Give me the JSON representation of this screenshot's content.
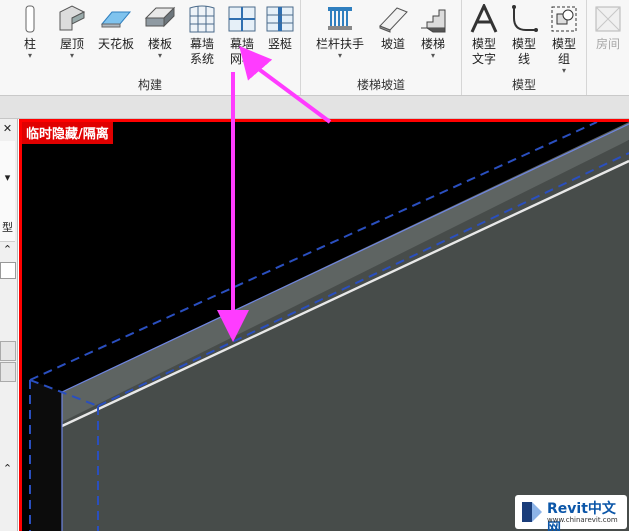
{
  "ribbon": {
    "build_group": {
      "label": "构建",
      "tools": [
        {
          "label": "柱",
          "has_dropdown": true
        },
        {
          "label": "屋顶",
          "has_dropdown": true
        },
        {
          "label": "天花板",
          "has_dropdown": false
        },
        {
          "label": "楼板",
          "has_dropdown": true
        },
        {
          "label": "幕墙\n系统",
          "has_dropdown": false
        },
        {
          "label": "幕墙\n网格",
          "has_dropdown": false
        },
        {
          "label": "竖梃",
          "has_dropdown": false
        }
      ]
    },
    "stairs_group": {
      "label": "楼梯坡道",
      "tools": [
        {
          "label": "栏杆扶手",
          "has_dropdown": true
        },
        {
          "label": "坡道",
          "has_dropdown": false
        },
        {
          "label": "楼梯",
          "has_dropdown": true
        }
      ]
    },
    "model_group": {
      "label": "模型",
      "tools": [
        {
          "label": "模型\n文字",
          "has_dropdown": false
        },
        {
          "label": "模型\n线",
          "has_dropdown": false
        },
        {
          "label": "模型\n组",
          "has_dropdown": true
        }
      ]
    },
    "room_tool": {
      "label": "房间",
      "enabled": false
    }
  },
  "left_panel": {
    "close_glyph": "✕",
    "dropdown_glyph": "▾",
    "type_label": "型",
    "collapse_glyph": "⌃"
  },
  "viewport": {
    "mode_banner": "临时隐藏/隔离",
    "watermark": {
      "brand": "Revit中文网",
      "url": "www.chinarevit.com"
    }
  },
  "colors": {
    "viewport_bg": "#000000",
    "wall_fill": "#474c4a",
    "highlight_border": "#ff0000",
    "annotation_arrow": "#ff3cff",
    "selection_blue": "#2a4fbf"
  }
}
